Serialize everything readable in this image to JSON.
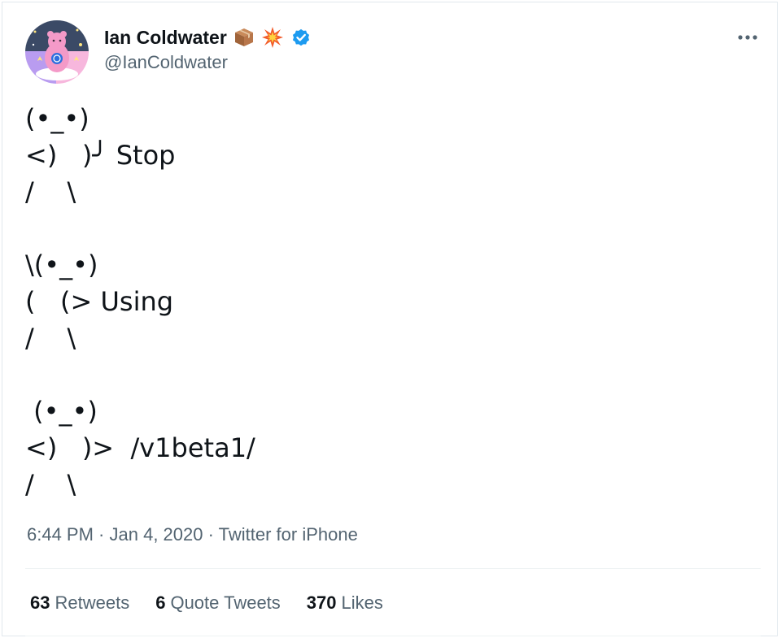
{
  "author": {
    "name": "Ian Coldwater",
    "handle": "@IanColdwater",
    "verified": true,
    "name_emojis": [
      "package-icon",
      "collision-icon"
    ]
  },
  "tweet": {
    "text": "(•_•)\n<)   )╯ Stop\n/    \\\n\n\\(•_•)\n(   (> Using\n/    \\\n\n (•_•)\n<)   )>  /v1beta1/\n/    \\"
  },
  "meta": {
    "time": "6:44 PM",
    "separator1": " · ",
    "date": "Jan 4, 2020",
    "separator2": " · ",
    "source": "Twitter for iPhone"
  },
  "stats": {
    "retweets_count": "63",
    "retweets_label": "Retweets",
    "quotes_count": "6",
    "quotes_label": "Quote Tweets",
    "likes_count": "370",
    "likes_label": "Likes"
  },
  "colors": {
    "verified_blue": "#1d9bf0",
    "secondary_text": "#536471",
    "primary_text": "#0f1419",
    "divider": "#eff3f4"
  }
}
